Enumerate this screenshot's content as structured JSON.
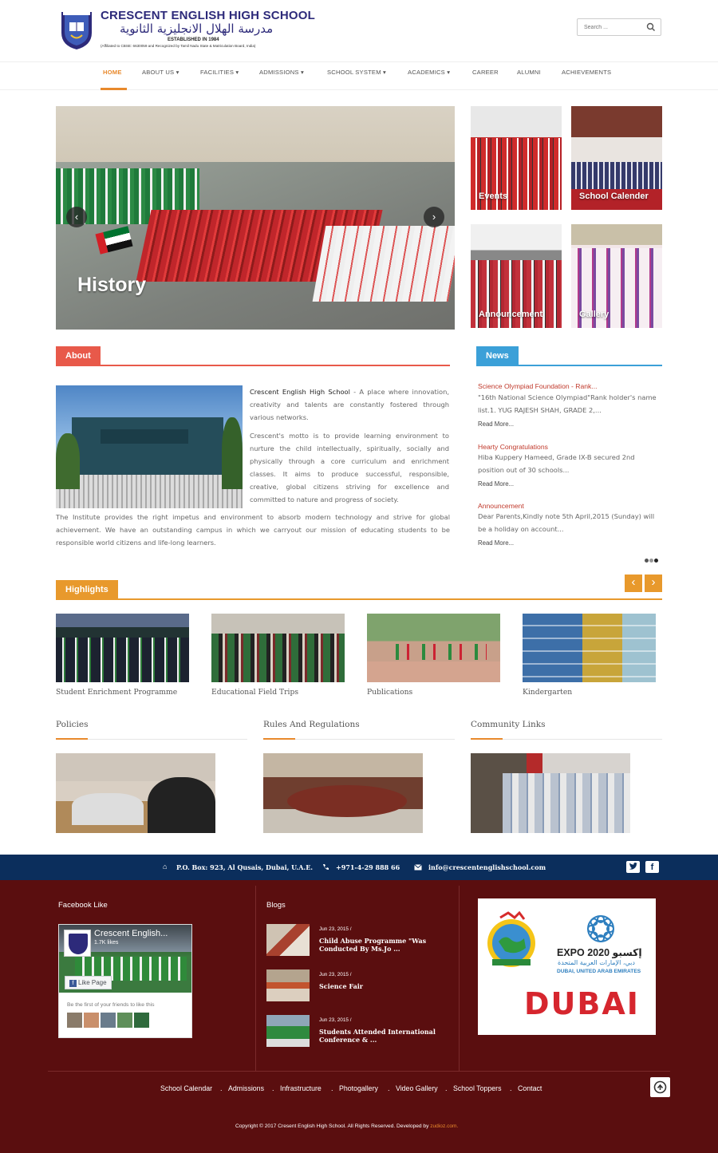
{
  "header": {
    "school_name_en": "CRESCENT ENGLISH HIGH SCHOOL",
    "school_name_ar": "مدرسة الهلال الانجليزية الثانوية",
    "established": "ESTABLISHED IN 1984",
    "affiliation": "(Affiliated to CBSE: 6630059 and Recognized by Tamil Nadu State & Matriculation Board, India)",
    "search_placeholder": "Search ..."
  },
  "nav": {
    "items": [
      {
        "label": "HOME",
        "active": true,
        "dropdown": false
      },
      {
        "label": "ABOUT US",
        "dropdown": true
      },
      {
        "label": "FACILITIES",
        "dropdown": true
      },
      {
        "label": "ADMISSIONS",
        "dropdown": true
      },
      {
        "label": "SCHOOL SYSTEM",
        "dropdown": true
      },
      {
        "label": "ACADEMICS",
        "dropdown": true
      },
      {
        "label": "CAREER",
        "dropdown": false
      },
      {
        "label": "ALUMNI",
        "dropdown": false
      },
      {
        "label": "ACHIEVEMENTS",
        "dropdown": false
      }
    ]
  },
  "slider": {
    "caption": "History"
  },
  "tiles": [
    "Events",
    "School Calender",
    "Announcement",
    "Gallery"
  ],
  "about": {
    "tab": "About",
    "lead_name": "Crescent English High School",
    "lead_rest": " - A place where innovation, creativity and talents are constantly fostered through various networks.",
    "para2": "Crescent's motto is to provide learning environment to nurture the child intellectually, spiritually, socially and physically through a core curriculum and enrichment classes. It aims to produce successful, responsible, creative, global citizens striving for excellence and committed to nature and progress of society.",
    "para3": "The Institute provides the right impetus and environment to absorb modern technology and strive for global achievement. We have an outstanding campus in which we carryout our mission of educating students to be responsible world citizens and life-long learners."
  },
  "news": {
    "tab": "News",
    "items": [
      {
        "title": "Science Olympiad Foundation - Rank...",
        "text": "\"16th National Science Olympiad\"Rank holder's name list.1. YUG RAJESH SHAH, GRADE 2,...",
        "more": "Read More..."
      },
      {
        "title": "Hearty Congratulations",
        "text": "Hiba Kuppery Hameed, Grade IX-B secured 2nd position out of 30 schools...",
        "more": "Read More..."
      },
      {
        "title": "Announcement",
        "text": "Dear Parents,Kindly note 5th April,2015 (Sunday) will be a holiday on account...",
        "more": "Read More..."
      }
    ]
  },
  "highlights": {
    "tab": "Highlights",
    "prev": "‹",
    "next": "›",
    "items": [
      "Student Enrichment Programme",
      "Educational Field Trips",
      "Publications",
      "Kindergarten"
    ]
  },
  "policies": [
    "Policies",
    "Rules And Regulations",
    "Community Links"
  ],
  "contact": {
    "address": "P.O. Box: 923, Al Qusais, Dubai, U.A.E.",
    "phone": "+971-4-29 888 66",
    "email": "info@crescentenglishschool.com"
  },
  "footer": {
    "facebook_head": "Facebook Like",
    "fb_name": "Crescent English...",
    "fb_likes": "1.7K likes",
    "fb_button": "Like Page",
    "fb_friends": "Be the first of your friends to like this",
    "blogs_head": "Blogs",
    "blogs": [
      {
        "date": "Jun 23, 2015 /",
        "title": "Child Abuse Programme \"Was Conducted By Ms.Jo ..."
      },
      {
        "date": "Jun 23, 2015 /",
        "title": "Science Fair"
      },
      {
        "date": "Jun 23, 2015 /",
        "title": "Students Attended International Conference & ..."
      }
    ],
    "expo_line1": "EXPO 2020",
    "expo_ar": "إكسبو",
    "expo_line2": "دبي، الإمارات العربية المتحدة",
    "expo_line3": "DUBAI, UNITED ARAB EMIRATES",
    "expo_dubai": "DUBAI",
    "links": [
      "School Calendar",
      "Admissions",
      "Infrastructure",
      "Photogallery",
      "Video Gallery",
      "School Toppers",
      "Contact"
    ],
    "copyright": "Copyright © 2017 Cresent English High School. All Rights Reserved. Developed by ",
    "developer": "zudioz.com."
  },
  "colors": {
    "accent": "#e8892c",
    "about_tab": "#e8594a",
    "news_tab": "#3ba0d8",
    "footer_bg": "#5a0e0f",
    "infobar_bg": "#0b2e5c"
  }
}
